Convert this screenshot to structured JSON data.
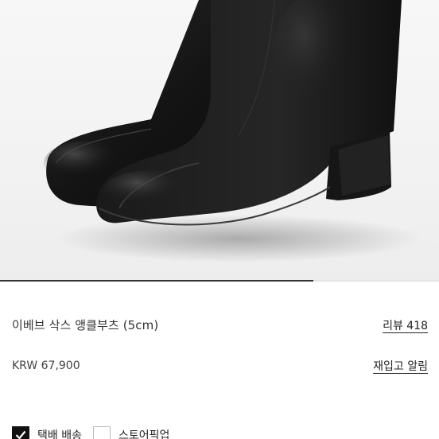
{
  "product": {
    "name": "이베브 삭스 앵클부츠 (5cm)",
    "review_link": "리뷰 418",
    "price": "KRW 67,900",
    "restock_link": "재입고 알림"
  },
  "carousel": {
    "progress": 0.714
  },
  "delivery_options": [
    {
      "label": "택배 배송",
      "checked": true
    },
    {
      "label": "스토어픽업",
      "checked": false
    }
  ]
}
